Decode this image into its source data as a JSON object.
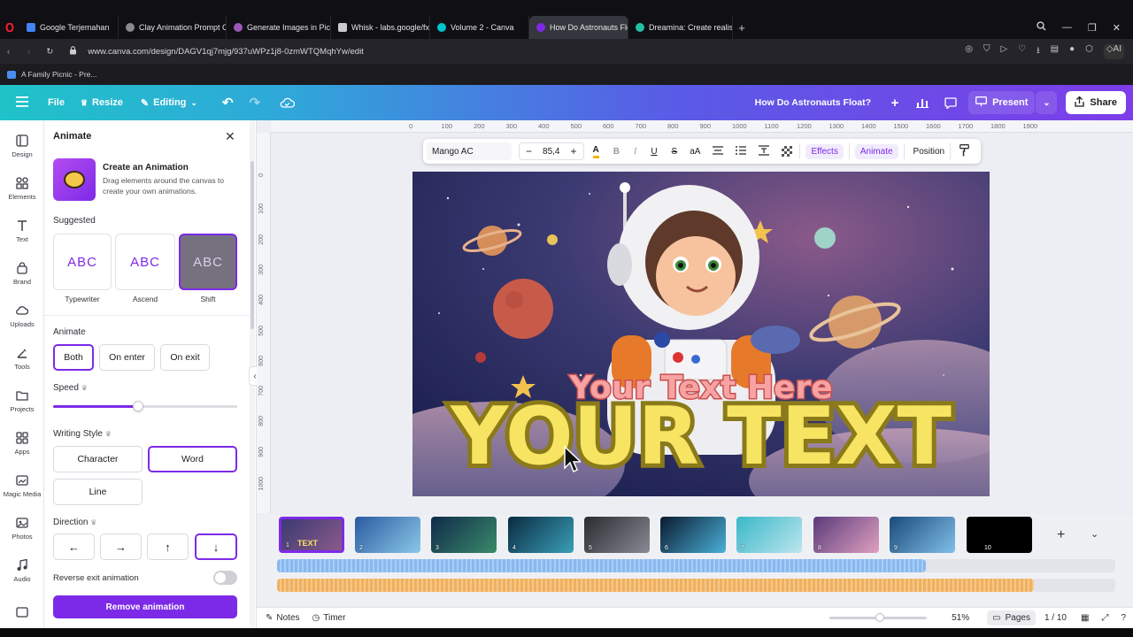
{
  "browser": {
    "tabs": [
      {
        "title": "Google Terjemahan",
        "color": "#4285f4"
      },
      {
        "title": "Clay Animation Prompt C",
        "color": "#8a8a8a"
      },
      {
        "title": "Generate Images in PicLu",
        "color": "#9b59b6"
      },
      {
        "title": "Whisk - labs.google/fx",
        "color": "#cccccc"
      },
      {
        "title": "Volume 2 - Canva",
        "color": "#00c4cc"
      },
      {
        "title": "How Do Astronauts Float",
        "color": "#7d2ae8"
      },
      {
        "title": "Dreamina: Create realistic",
        "color": "#22c1a6"
      }
    ],
    "url": "www.canva.com/design/DAGV1qj7mjg/937uWPz1j8-0zmWTQMqhYw/edit",
    "bookmark": "A Family Picnic - Pre..."
  },
  "header": {
    "file": "File",
    "resize": "Resize",
    "editing": "Editing",
    "title": "How Do Astronauts Float?",
    "present": "Present",
    "share": "Share"
  },
  "rail": {
    "items": [
      "Design",
      "Elements",
      "Text",
      "Brand",
      "Uploads",
      "Tools",
      "Projects",
      "Apps",
      "Magic Media",
      "Photos",
      "Audio"
    ]
  },
  "panel": {
    "title": "Animate",
    "create_title": "Create an Animation",
    "create_desc": "Drag elements around the canvas to create your own animations.",
    "suggested": "Suggested",
    "suggestions": [
      {
        "label": "Typewriter",
        "sample": "ABC"
      },
      {
        "label": "Ascend",
        "sample": "ABC"
      },
      {
        "label": "Shift",
        "sample": "ABC"
      }
    ],
    "animate_label": "Animate",
    "animate_options": [
      "Both",
      "On enter",
      "On exit"
    ],
    "speed_label": "Speed",
    "speed_value": 0.46,
    "writing_style_label": "Writing Style",
    "writing_styles": [
      "Character",
      "Word",
      "Line"
    ],
    "direction_label": "Direction",
    "directions": [
      "←",
      "→",
      "↑",
      "↓"
    ],
    "reverse_label": "Reverse exit animation",
    "remove_button": "Remove animation"
  },
  "ruler": {
    "h": [
      "0",
      "100",
      "200",
      "300",
      "400",
      "500",
      "600",
      "700",
      "800",
      "900",
      "1000",
      "1100",
      "1200",
      "1300",
      "1400",
      "1500",
      "1600",
      "1700",
      "1800",
      "1900"
    ],
    "v": [
      "0",
      "100",
      "200",
      "300",
      "400",
      "500",
      "600",
      "700",
      "800",
      "900",
      "1000"
    ]
  },
  "toolbar": {
    "font": "Mango AC",
    "size": "85,4",
    "minus": "−",
    "plus": "+",
    "effects": "Effects",
    "animate": "Animate",
    "position": "Position"
  },
  "artboard": {
    "subtitle": "Your Text Here",
    "headline": "YOUR TEXT"
  },
  "pages": {
    "thumbs": [
      "1",
      "2",
      "3",
      "4",
      "5",
      "6",
      "7",
      "8",
      "9",
      "10"
    ]
  },
  "bottom": {
    "notes": "Notes",
    "timer": "Timer",
    "zoom": "51%",
    "pages": "Pages",
    "page_count": "1 / 10"
  }
}
